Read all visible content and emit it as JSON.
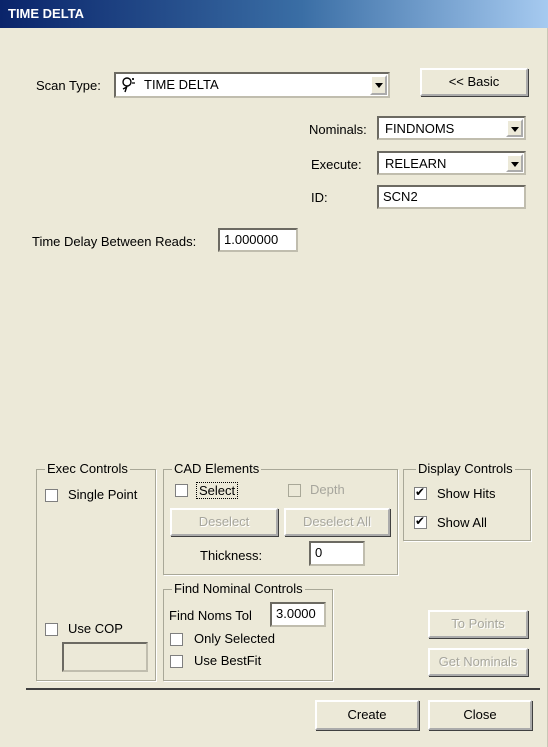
{
  "window": {
    "title": "TIME DELTA"
  },
  "scan": {
    "label": "Scan Type:",
    "icon": "scan-tool-icon",
    "value": "TIME DELTA"
  },
  "basic_button": "<< Basic",
  "nominals": {
    "label": "Nominals:",
    "value": "FINDNOMS"
  },
  "execute": {
    "label": "Execute:",
    "value": "RELEARN"
  },
  "id": {
    "label": "ID:",
    "value": "SCN2"
  },
  "time_delay": {
    "label": "Time Delay Between Reads:",
    "value": "1.000000"
  },
  "exec_controls": {
    "title": "Exec Controls",
    "single_point": "Single Point",
    "use_cop": "Use COP",
    "cop_value": ""
  },
  "cad_elements": {
    "title": "CAD Elements",
    "select": "Select",
    "depth": "Depth",
    "deselect": "Deselect",
    "deselect_all": "Deselect All",
    "thickness_label": "Thickness:",
    "thickness_value": "0"
  },
  "display_controls": {
    "title": "Display Controls",
    "show_hits": "Show Hits",
    "show_all": "Show All"
  },
  "find_nominal": {
    "title": "Find Nominal Controls",
    "tol_label": "Find Noms Tol",
    "tol_value": "3.0000",
    "only_selected": "Only Selected",
    "use_bestfit": "Use BestFit"
  },
  "side_buttons": {
    "to_points": "To Points",
    "get_nominals": "Get Nominals"
  },
  "footer": {
    "create": "Create",
    "close": "Close"
  }
}
